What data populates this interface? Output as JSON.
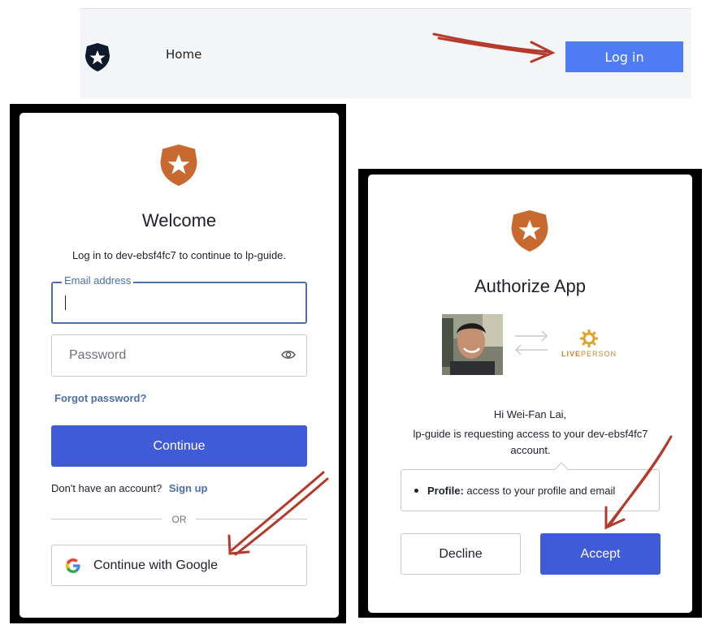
{
  "nav": {
    "home_label": "Home",
    "login_label": "Log in"
  },
  "login_card": {
    "title": "Welcome",
    "subtitle": "Log in to dev-ebsf4fc7 to continue to lp-guide.",
    "email_label": "Email address",
    "email_value": "",
    "password_placeholder": "Password",
    "forgot_password": "Forgot password?",
    "continue_label": "Continue",
    "no_account_text": "Don't have an account?",
    "signup_label": "Sign up",
    "or_text": "OR",
    "google_label": "Continue with Google"
  },
  "authorize_card": {
    "title": "Authorize App",
    "greeting": "Hi Wei-Fan Lai,",
    "request_line1": "lp-guide is requesting access to your dev-ebsf4fc7",
    "request_line2": "account.",
    "scope_name": "Profile:",
    "scope_desc": "access to your profile and email",
    "liveperson_a": "LIVE",
    "liveperson_b": "PERSON",
    "decline_label": "Decline",
    "accept_label": "Accept"
  },
  "colors": {
    "brand_orange": "#c8692f",
    "primary_button": "#3f5bd8",
    "nav_login_button": "#4d7cf5",
    "link": "#4c6fa8",
    "annotation_arrow": "#b63a2b"
  },
  "icons": [
    "auth0-shield-icon",
    "eye-icon",
    "google-icon",
    "swap-arrows-icon",
    "liveperson-sun-icon"
  ]
}
